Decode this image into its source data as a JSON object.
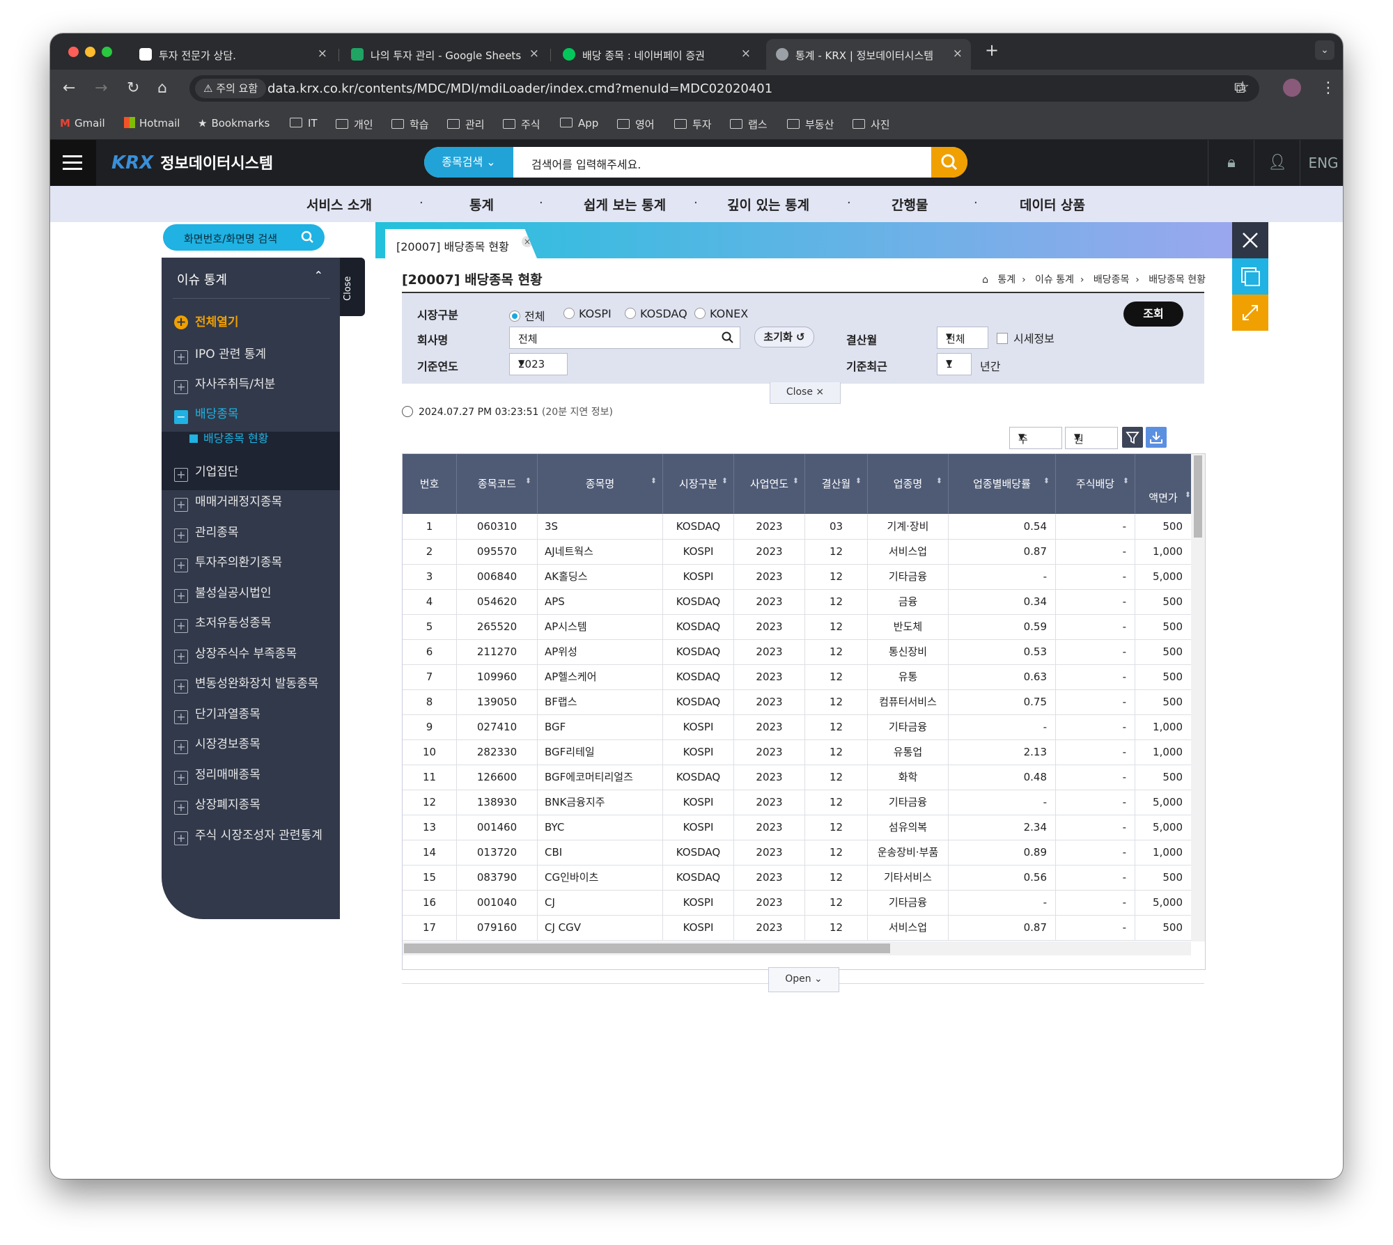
{
  "browser": {
    "tabs": [
      {
        "title": "투자 전문가 상담.",
        "icon_color": "#ffffff"
      },
      {
        "title": "나의 투자 관리 - Google Sheets",
        "icon_color": "#1fa463"
      },
      {
        "title": "배당 종목 : 네이버페이 증권",
        "icon_color": "#03c75a"
      },
      {
        "title": "통계 - KRX | 정보데이터시스템",
        "icon_color": "#9aa0a6"
      }
    ],
    "security_label": "주의 요함",
    "url": "data.krx.co.kr/contents/MDC/MDI/mdiLoader/index.cmd?menuId=MDC02020401",
    "bookmarks": [
      "Gmail",
      "Hotmail",
      "Bookmarks",
      "IT",
      "개인",
      "학습",
      "관리",
      "주식",
      "App",
      "영어",
      "투자",
      "랩스",
      "부동산",
      "사진"
    ]
  },
  "site": {
    "logo_mark": "KRX",
    "logo_text": "정보데이터시스템",
    "search_type": "종목검색",
    "search_placeholder": "검색어를 입력해주세요.",
    "lang": "ENG",
    "accent": "#21a3d8",
    "search_btn_color": "#f0a000",
    "gnb": [
      "서비스 소개",
      "통계",
      "쉽게 보는 통계",
      "깊이 있는 통계",
      "간행물",
      "데이터 상품"
    ]
  },
  "sidebar": {
    "search": "화면번호/화면명 검색",
    "title": "이슈 통계",
    "open_all": "전체열기",
    "close_tab": "Close",
    "items": [
      "IPO 관련 통계",
      "자사주취득/처분",
      "배당종목",
      "기업집단",
      "매매거래정지종목",
      "관리종목",
      "투자주의환기종목",
      "불성실공시법인",
      "초저유동성종목",
      "상장주식수 부족종목",
      "변동성완화장치 발동종목",
      "단기과열종목",
      "시장경보종목",
      "정리매매종목",
      "상장폐지종목",
      "주식 시장조성자 관련통계"
    ],
    "sub_item": "배당종목 현황"
  },
  "page": {
    "tab_label": "[20007] 배당종목 현황",
    "title": "[20007] 배당종목 현황",
    "breadcrumb": [
      "통계",
      "이슈 통계",
      "배당종목",
      "배당종목 현황"
    ],
    "filters": {
      "market_label": "시장구분",
      "markets": [
        "전체",
        "KOSPI",
        "KOSDAQ",
        "KONEX"
      ],
      "company_label": "회사명",
      "company_value": "전체",
      "year_label": "기준연도",
      "year_value": "2023",
      "settle_label": "결산월",
      "settle_value": "전체",
      "market_info": "시세정보",
      "recent_label": "기준최근",
      "recent_value": "1",
      "recent_unit": "년간",
      "reset": "초기화",
      "search": "조회",
      "close": "Close"
    },
    "timestamp": "2024.07.27 PM 03:23:51",
    "delay_note": "(20분 지연 정보)",
    "unit_share": "주",
    "unit_money": "원",
    "open": "Open"
  },
  "table": {
    "headers": [
      "번호",
      "종목코드",
      "종목명",
      "시장구분",
      "사업연도",
      "결산월",
      "업종명",
      "업종별배당률",
      "주식배당",
      "액면가"
    ],
    "rows": [
      [
        "1",
        "060310",
        "3S",
        "KOSDAQ",
        "2023",
        "03",
        "기계·장비",
        "0.54",
        "-",
        "500"
      ],
      [
        "2",
        "095570",
        "AJ네트웍스",
        "KOSPI",
        "2023",
        "12",
        "서비스업",
        "0.87",
        "-",
        "1,000"
      ],
      [
        "3",
        "006840",
        "AK홀딩스",
        "KOSPI",
        "2023",
        "12",
        "기타금융",
        "-",
        "-",
        "5,000"
      ],
      [
        "4",
        "054620",
        "APS",
        "KOSDAQ",
        "2023",
        "12",
        "금융",
        "0.34",
        "-",
        "500"
      ],
      [
        "5",
        "265520",
        "AP시스템",
        "KOSDAQ",
        "2023",
        "12",
        "반도체",
        "0.59",
        "-",
        "500"
      ],
      [
        "6",
        "211270",
        "AP위성",
        "KOSDAQ",
        "2023",
        "12",
        "통신장비",
        "0.53",
        "-",
        "500"
      ],
      [
        "7",
        "109960",
        "AP헬스케어",
        "KOSDAQ",
        "2023",
        "12",
        "유통",
        "0.63",
        "-",
        "500"
      ],
      [
        "8",
        "139050",
        "BF랩스",
        "KOSDAQ",
        "2023",
        "12",
        "컴퓨터서비스",
        "0.75",
        "-",
        "500"
      ],
      [
        "9",
        "027410",
        "BGF",
        "KOSPI",
        "2023",
        "12",
        "기타금융",
        "-",
        "-",
        "1,000"
      ],
      [
        "10",
        "282330",
        "BGF리테일",
        "KOSPI",
        "2023",
        "12",
        "유통업",
        "2.13",
        "-",
        "1,000"
      ],
      [
        "11",
        "126600",
        "BGF에코머티리얼즈",
        "KOSDAQ",
        "2023",
        "12",
        "화학",
        "0.48",
        "-",
        "500"
      ],
      [
        "12",
        "138930",
        "BNK금융지주",
        "KOSPI",
        "2023",
        "12",
        "기타금융",
        "-",
        "-",
        "5,000"
      ],
      [
        "13",
        "001460",
        "BYC",
        "KOSPI",
        "2023",
        "12",
        "섬유의복",
        "2.34",
        "-",
        "5,000"
      ],
      [
        "14",
        "013720",
        "CBI",
        "KOSDAQ",
        "2023",
        "12",
        "운송장비·부품",
        "0.89",
        "-",
        "1,000"
      ],
      [
        "15",
        "083790",
        "CG인바이츠",
        "KOSDAQ",
        "2023",
        "12",
        "기타서비스",
        "0.56",
        "-",
        "500"
      ],
      [
        "16",
        "001040",
        "CJ",
        "KOSPI",
        "2023",
        "12",
        "기타금융",
        "-",
        "-",
        "5,000"
      ],
      [
        "17",
        "079160",
        "CJ CGV",
        "KOSPI",
        "2023",
        "12",
        "서비스업",
        "0.87",
        "-",
        "500"
      ]
    ]
  }
}
